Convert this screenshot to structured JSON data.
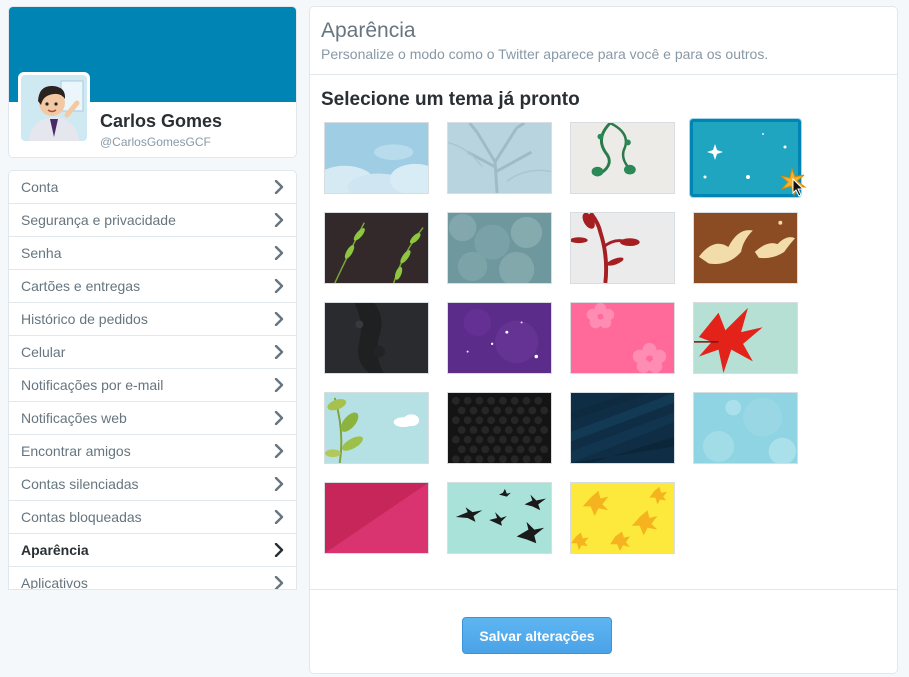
{
  "profile": {
    "name": "Carlos Gomes",
    "handle": "@CarlosGomesGCF",
    "banner_color": "#0084b4"
  },
  "menu": {
    "items": [
      {
        "label": "Conta",
        "active": false
      },
      {
        "label": "Segurança e privacidade",
        "active": false
      },
      {
        "label": "Senha",
        "active": false
      },
      {
        "label": "Cartões e entregas",
        "active": false
      },
      {
        "label": "Histórico de pedidos",
        "active": false
      },
      {
        "label": "Celular",
        "active": false
      },
      {
        "label": "Notificações por e-mail",
        "active": false
      },
      {
        "label": "Notificações web",
        "active": false
      },
      {
        "label": "Encontrar amigos",
        "active": false
      },
      {
        "label": "Contas silenciadas",
        "active": false
      },
      {
        "label": "Contas bloqueadas",
        "active": false
      },
      {
        "label": "Aparência",
        "active": true
      },
      {
        "label": "Aplicativos",
        "active": false
      }
    ],
    "chevron_icon": "chevron-right-icon"
  },
  "panel": {
    "title": "Aparência",
    "subtitle": "Personalize o modo como o Twitter aparece para você e para os outros.",
    "section_title": "Selecione um tema já pronto"
  },
  "themes": {
    "selected_index": 3,
    "items": [
      {
        "name": "clouds",
        "icon": "clouds-theme-thumbnail"
      },
      {
        "name": "tree-branches",
        "icon": "branches-theme-thumbnail"
      },
      {
        "name": "green-vine",
        "icon": "vine-theme-thumbnail"
      },
      {
        "name": "sparkles",
        "icon": "sparkles-theme-thumbnail"
      },
      {
        "name": "green-leaves-dark",
        "icon": "leaves-theme-thumbnail"
      },
      {
        "name": "foliage",
        "icon": "foliage-theme-thumbnail"
      },
      {
        "name": "red-leaf",
        "icon": "red-leaf-theme-thumbnail"
      },
      {
        "name": "doves-brown",
        "icon": "doves-theme-thumbnail"
      },
      {
        "name": "dark-texture",
        "icon": "dark-texture-theme-thumbnail"
      },
      {
        "name": "purple-stars",
        "icon": "purple-stars-theme-thumbnail"
      },
      {
        "name": "pink-flowers",
        "icon": "pink-flowers-theme-thumbnail"
      },
      {
        "name": "red-maple",
        "icon": "maple-theme-thumbnail"
      },
      {
        "name": "leaves-sky",
        "icon": "leaves-sky-theme-thumbnail"
      },
      {
        "name": "black-honeycomb",
        "icon": "honeycomb-theme-thumbnail"
      },
      {
        "name": "navy-rays",
        "icon": "rays-theme-thumbnail"
      },
      {
        "name": "light-bokeh",
        "icon": "bokeh-theme-thumbnail"
      },
      {
        "name": "magenta-diagonal",
        "icon": "magenta-theme-thumbnail"
      },
      {
        "name": "birds",
        "icon": "birds-theme-thumbnail"
      },
      {
        "name": "yellow-leaves",
        "icon": "yellow-leaves-theme-thumbnail"
      }
    ]
  },
  "footer": {
    "save_label": "Salvar alterações"
  },
  "colors": {
    "accent": "#0084b4",
    "button": "#55acee"
  }
}
